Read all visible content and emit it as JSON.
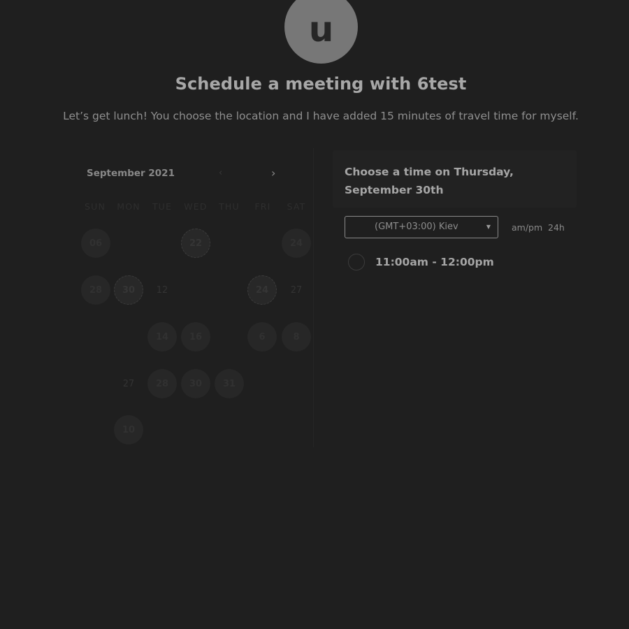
{
  "avatar": {
    "initial": "u"
  },
  "header": {
    "title": "Schedule a meeting with 6test",
    "subtitle": "Let’s get lunch! You choose the location and I have added 15 minutes of travel time for myself."
  },
  "calendar": {
    "month": "September 2021",
    "prev_icon": "chevron-left-icon",
    "next_icon": "chevron-right-icon",
    "prev_glyph": "‹",
    "next_glyph": "›",
    "weekdays": [
      "SUN",
      "MON",
      "TUE",
      "WED",
      "THU",
      "FRI",
      "SAT"
    ],
    "days": {
      "d1": "06",
      "d2": "22",
      "d3": "24",
      "d4": "28",
      "d5": "30",
      "d6": "12",
      "d7": "24",
      "d8": "27",
      "d9": "14",
      "d10": "16",
      "d11": "6",
      "d12": "8",
      "d13": "27",
      "d14": "28",
      "d15": "30",
      "d16": "31",
      "d17": "10"
    }
  },
  "time_panel": {
    "heading": "Choose a time on Thursday, September 30th",
    "timezone": "(GMT+03:00) Kiev",
    "caret_icon": "caret-down-icon",
    "caret_glyph": "▼",
    "format_ampm": "am/pm",
    "format_24h": "24h",
    "slots": [
      {
        "label": "11:00am - 12:00pm"
      }
    ]
  }
}
